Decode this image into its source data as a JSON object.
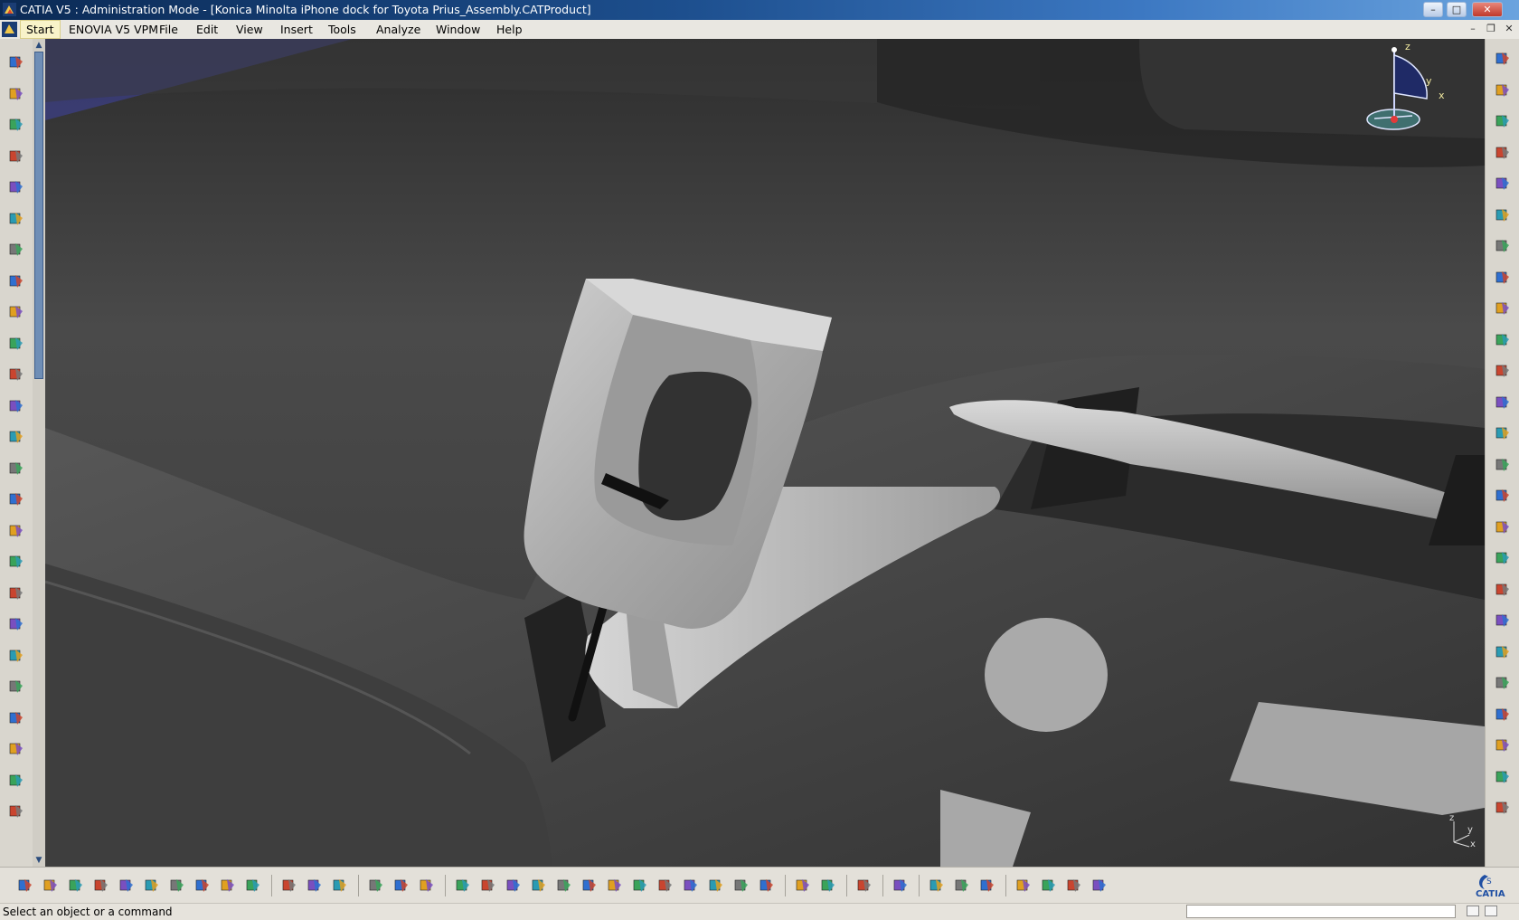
{
  "window": {
    "title": "CATIA V5 : Administration Mode - [Konica Minolta iPhone dock for Toyota Prius_Assembly.CATProduct]",
    "minimize_label": "–",
    "maximize_label": "□",
    "close_label": "✕"
  },
  "menubar": {
    "items": [
      {
        "label": "Start"
      },
      {
        "label": "ENOVIA V5 VPM"
      },
      {
        "label": "File"
      },
      {
        "label": "Edit"
      },
      {
        "label": "View"
      },
      {
        "label": "Insert"
      },
      {
        "label": "Tools"
      },
      {
        "label": "Analyze"
      },
      {
        "label": "Window"
      },
      {
        "label": "Help"
      }
    ],
    "doc_minimize_label": "–",
    "doc_restore_label": "❐",
    "doc_close_label": "✕"
  },
  "compass": {
    "z_label": "z",
    "y_label": "y",
    "x_label": "x"
  },
  "axis_triad": {
    "z_label": "z",
    "y_label": "y",
    "x_label": "x"
  },
  "left_toolbar": {
    "icons": [
      "point-icon",
      "spline-icon",
      "curve-icon",
      "plane-icon",
      "new-part-icon",
      "existing-component-icon",
      "replace-component-icon",
      "graph-tree-icon",
      "fix-constraint-icon",
      "coincidence-icon",
      "contact-constraint-icon",
      "offset-constraint-icon",
      "angle-constraint-icon",
      "fix-together-icon",
      "quick-constraint-icon",
      "reuse-pattern-icon",
      "annotation-text-icon",
      "abc-text-icon",
      "flag-note-icon",
      "weld-icon",
      "cut-icon",
      "scene-icon",
      "explode-icon",
      "sections-icon",
      "clash-icon"
    ]
  },
  "right_toolbar": {
    "icons": [
      "clash-analysis-icon",
      "select-icon",
      "manipulation-icon",
      "product-icon",
      "component-icon",
      "part-icon",
      "new-from-icon",
      "split-icon",
      "hole-icon",
      "fastening-icon",
      "annotation-icon",
      "bom-icon",
      "catalog-icon",
      "publish-icon",
      "compare-icon",
      "measure-inertia-icon",
      "smart-move-icon",
      "snap-icon",
      "assembly-feature-icon",
      "pocket-icon",
      "add-icon",
      "remove-icon",
      "generate-numbering-icon",
      "bill-of-material-icon",
      "scene-list-icon"
    ]
  },
  "bottom_toolbar": {
    "icons": [
      "new-icon",
      "open-icon",
      "save-icon",
      "print-icon",
      "cut-icon",
      "copy-icon",
      "paste-icon",
      "undo-icon",
      "redo-icon",
      "whats-this-icon",
      "formula-icon",
      "catalog-browser-icon",
      "light-icon",
      "table-icon",
      "tree-icon",
      "library-icon",
      "align-icon",
      "fly-mode-icon",
      "fit-all-icon",
      "pan-icon",
      "rotate-icon",
      "zoom-in-icon",
      "zoom-out-icon",
      "normal-view-icon",
      "multi-view-icon",
      "iso-view-icon",
      "hide-show-icon",
      "swap-visible-icon",
      "shading-icon",
      "update-icon",
      "capture-icon",
      "compass-icon",
      "grid-icon",
      "apply-material-icon",
      "render-icon",
      "design-mode-icon",
      "sketch-icon",
      "measure-between-icon",
      "measure-item-icon",
      "measure-inertia-icon"
    ],
    "catia_logo": "CATIA"
  },
  "statusbar": {
    "message": "Select an object or a command",
    "command_input": ""
  },
  "colors": {
    "title_dark": "#0b2a55",
    "title_light": "#6aa3de",
    "viewport_dark": "#3a3a3a",
    "part_gray": "#b4b4b4",
    "scrollbar_thumb": "#6f8eb6"
  }
}
